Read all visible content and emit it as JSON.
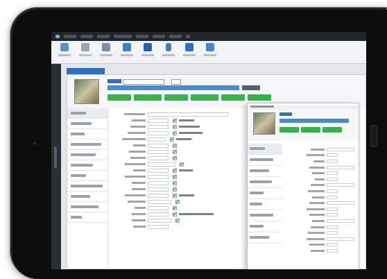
{
  "device": {
    "type": "tablet"
  },
  "window": {
    "title": ""
  },
  "menubar": {
    "items": [
      "",
      "",
      "",
      "",
      "",
      "",
      "",
      ""
    ]
  },
  "ribbon": {
    "buttons": [
      {
        "icon": "brush-icon",
        "label": ""
      },
      {
        "icon": "document-icon",
        "label": ""
      },
      {
        "icon": "table-icon",
        "label": ""
      },
      {
        "icon": "chart-icon",
        "label": ""
      },
      {
        "icon": "font-icon",
        "label": ""
      },
      {
        "icon": "bottle-icon",
        "label": ""
      },
      {
        "icon": "export-icon",
        "label": ""
      },
      {
        "icon": "save-icon",
        "label": ""
      }
    ]
  },
  "side_strip": {
    "label": ""
  },
  "tab": {
    "label": ""
  },
  "record": {
    "code": "",
    "title": "",
    "title_suffix": "",
    "actions": [
      "",
      "",
      "",
      "",
      "",
      ""
    ]
  },
  "sidebar": {
    "items": [
      "",
      "",
      "",
      "",
      "",
      "",
      "",
      "",
      "",
      "",
      ""
    ]
  },
  "form": {
    "fields": [
      {
        "label": "",
        "value": "",
        "checkbox": ""
      },
      {
        "label": "",
        "value": "",
        "checkbox": ""
      },
      {
        "label": "",
        "value": "",
        "checkbox": ""
      },
      {
        "label": "",
        "value": "",
        "checkbox": ""
      },
      {
        "label": "",
        "value": "",
        "checkbox": ""
      },
      {
        "label": "",
        "value": "",
        "checkbox": ""
      },
      {
        "label": "",
        "value": "",
        "checkbox": ""
      },
      {
        "label": "",
        "value": "",
        "checkbox": ""
      },
      {
        "label": "",
        "value": "",
        "checkbox": ""
      },
      {
        "label": "",
        "value": "",
        "checkbox": ""
      },
      {
        "label": "",
        "value": "",
        "checkbox": ""
      },
      {
        "label": "",
        "value": "",
        "checkbox": ""
      },
      {
        "label": "",
        "value": "",
        "checkbox": ""
      },
      {
        "label": "",
        "value": "",
        "checkbox": ""
      },
      {
        "label": "",
        "value": "",
        "checkbox": ""
      },
      {
        "label": "",
        "value": "",
        "checkbox": ""
      },
      {
        "label": "",
        "value": "",
        "checkbox": ""
      },
      {
        "label": "",
        "value": "",
        "checkbox": ""
      },
      {
        "label": "",
        "value": "",
        "checkbox": ""
      }
    ],
    "section_title": ""
  },
  "dialog": {
    "title": "",
    "code": "",
    "record_title": "",
    "actions": [
      "",
      "",
      ""
    ],
    "sidebar_items": [
      "",
      "",
      "",
      "",
      "",
      "",
      "",
      "",
      ""
    ],
    "fields": [
      {
        "label": "",
        "value": ""
      },
      {
        "label": "",
        "value": ""
      },
      {
        "label": "",
        "value": ""
      },
      {
        "label": "",
        "value": ""
      },
      {
        "label": "",
        "value": ""
      },
      {
        "label": "",
        "value": ""
      },
      {
        "label": "",
        "value": ""
      },
      {
        "label": "",
        "value": ""
      },
      {
        "label": "",
        "value": ""
      },
      {
        "label": "",
        "value": ""
      },
      {
        "label": "",
        "value": ""
      },
      {
        "label": "",
        "value": ""
      },
      {
        "label": "",
        "value": ""
      },
      {
        "label": "",
        "value": ""
      },
      {
        "label": "",
        "value": ""
      },
      {
        "label": "",
        "value": ""
      },
      {
        "label": "",
        "value": ""
      },
      {
        "label": "",
        "value": ""
      }
    ]
  },
  "colors": {
    "accent": "#2f6fc4",
    "action": "#35b24a",
    "menubar": "#20252c"
  }
}
